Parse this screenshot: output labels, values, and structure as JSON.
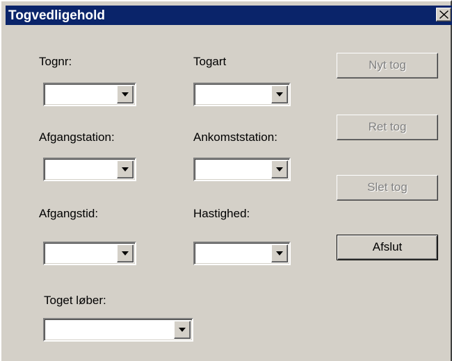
{
  "window": {
    "title": "Togvedligehold",
    "close_icon": "close-icon"
  },
  "fields": {
    "tognr": {
      "label": "Tognr:",
      "value": ""
    },
    "togart": {
      "label": "Togart",
      "value": ""
    },
    "afgangstation": {
      "label": "Afgangstation:",
      "value": ""
    },
    "ankomststation": {
      "label": "Ankomststation:",
      "value": ""
    },
    "afgangstid": {
      "label": "Afgangstid:",
      "value": ""
    },
    "hastighed": {
      "label": "Hastighed:",
      "value": ""
    },
    "toget_lober": {
      "label": "Toget løber:",
      "value": ""
    }
  },
  "buttons": {
    "nyt_tog": "Nyt tog",
    "ret_tog": "Ret tog",
    "slet_tog": "Slet tog",
    "afslut": "Afslut"
  },
  "colors": {
    "titlebar": "#0a246a",
    "face": "#d4d0c8",
    "disabled_text": "#808080"
  }
}
